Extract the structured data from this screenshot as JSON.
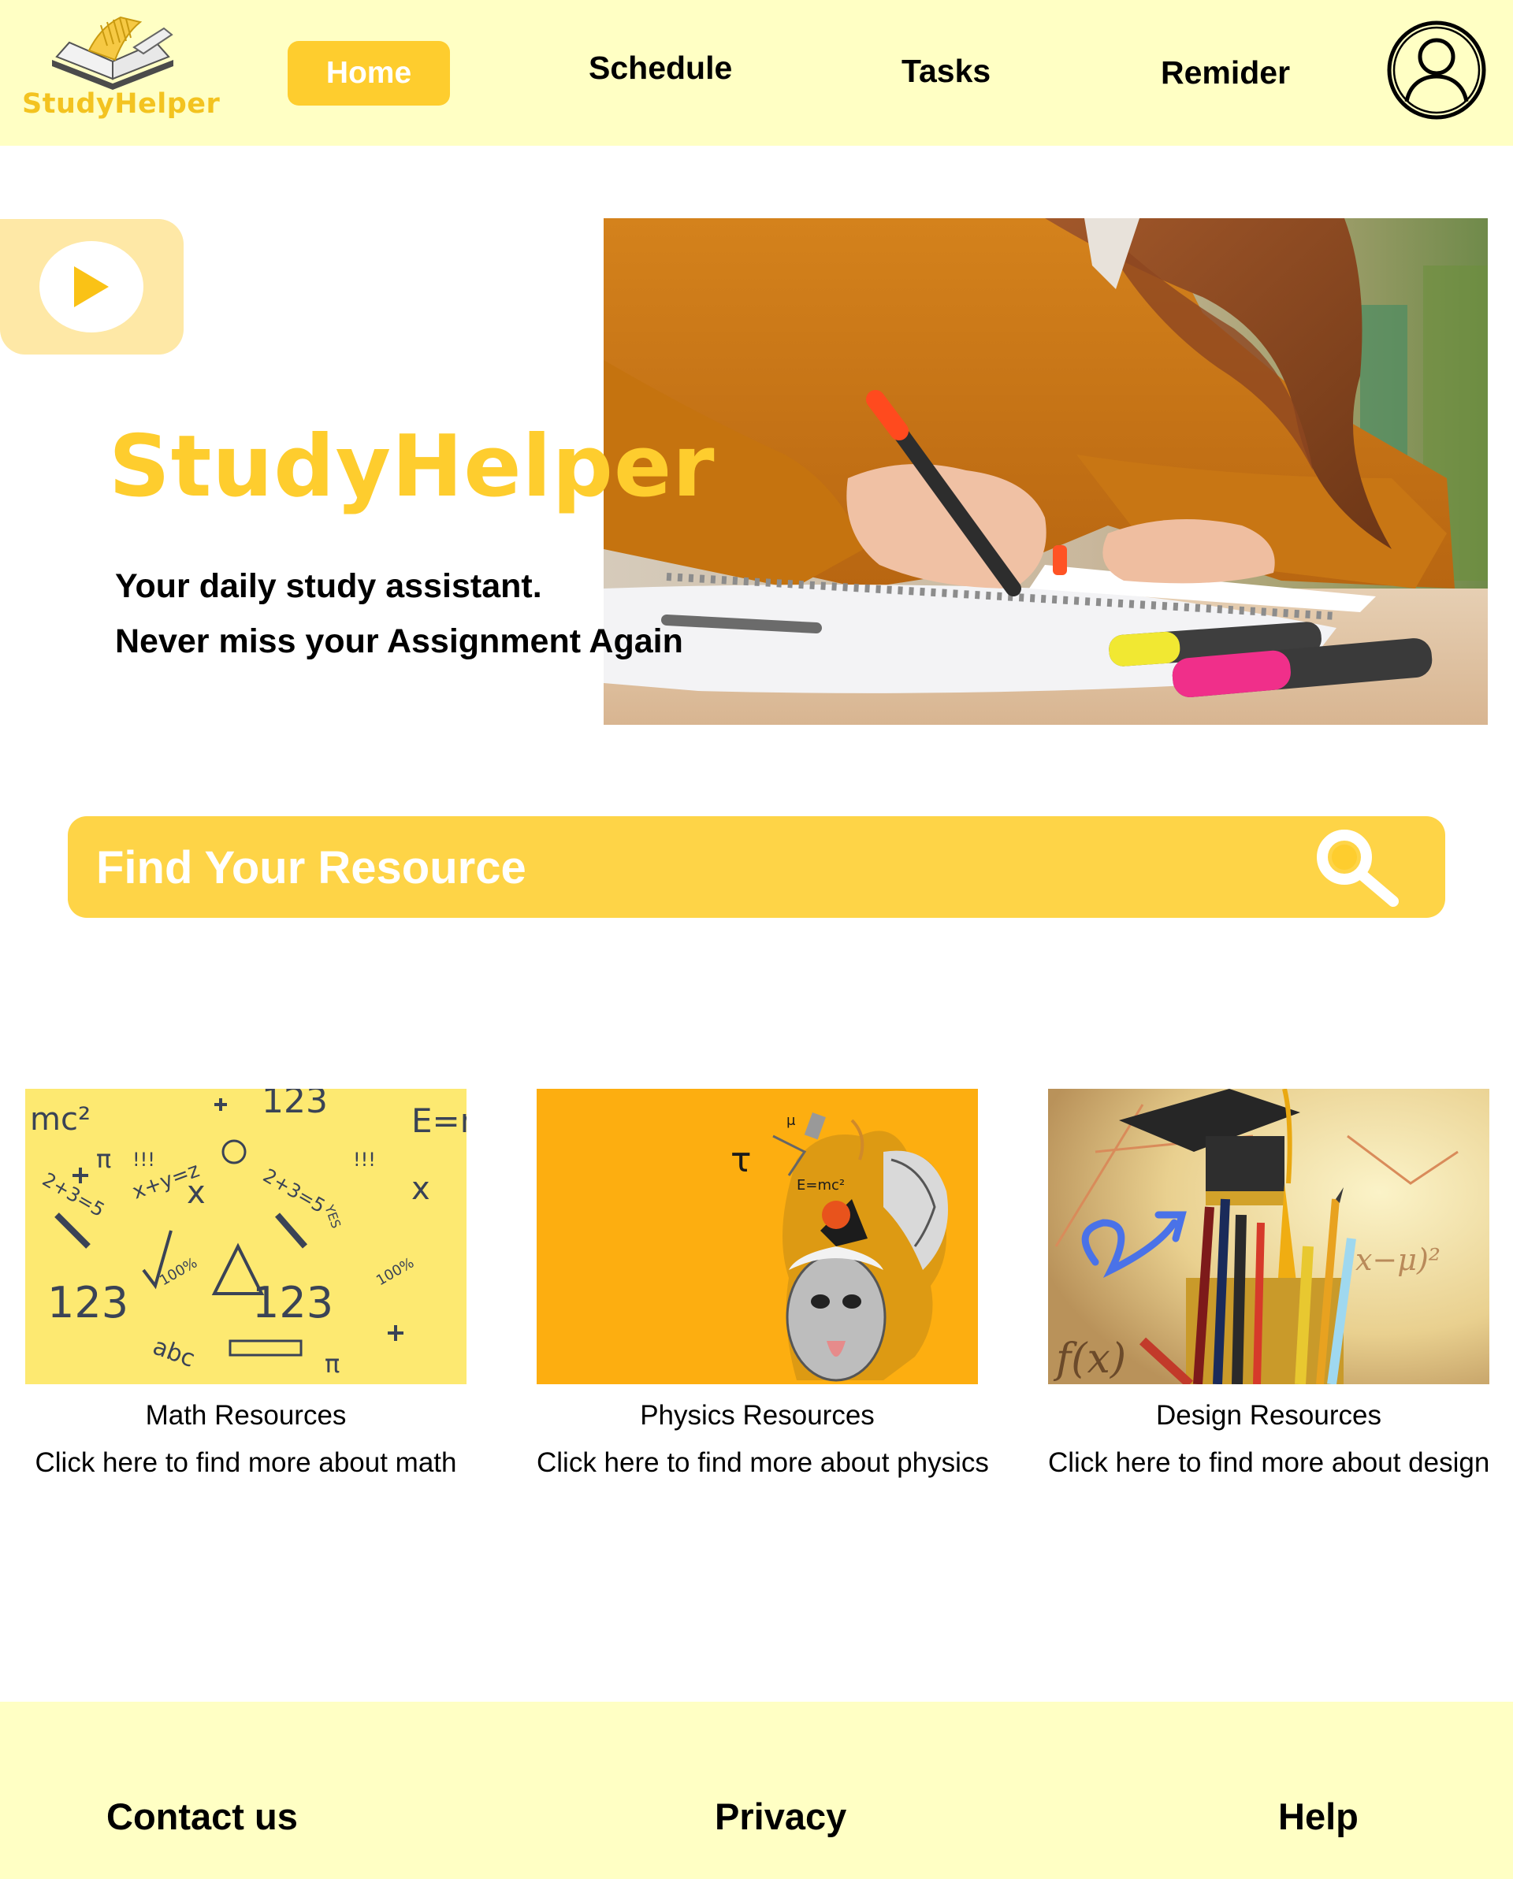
{
  "brand": {
    "logo_text": "StudyHelper",
    "accent_color": "#fecd2e",
    "header_bg": "#ffffc4"
  },
  "nav": {
    "items": [
      {
        "label": "Home",
        "active": true
      },
      {
        "label": "Schedule",
        "active": false
      },
      {
        "label": "Tasks",
        "active": false
      },
      {
        "label": "Remider",
        "active": false
      }
    ],
    "profile_icon": "user-circle-icon"
  },
  "hero": {
    "play_icon": "play-icon",
    "title": "StudyHelper",
    "line1": "Your daily study assistant.",
    "line2": "Never miss your Assignment Again"
  },
  "search": {
    "placeholder": "Find Your Resource",
    "value": "",
    "icon": "search-icon"
  },
  "resources": [
    {
      "title": "Math Resources",
      "link": "Click here to find more about math"
    },
    {
      "title": "Physics Resources",
      "link": "Click here to find more about physics"
    },
    {
      "title": "Design Resources",
      "link": "Click here to find more about design"
    }
  ],
  "footer": {
    "contact": "Contact us",
    "privacy": "Privacy",
    "help": "Help"
  },
  "math_doodles": [
    "mc²",
    "123",
    "E=m",
    "x+y=z",
    "abc",
    "123",
    "x",
    "π",
    "!!!",
    "2+3=5",
    "100%",
    "YES"
  ],
  "physics_doodles": [
    "τ",
    "E=mc²",
    "μ"
  ],
  "design_doodles": [
    "f(x)",
    "x−μ)²"
  ]
}
